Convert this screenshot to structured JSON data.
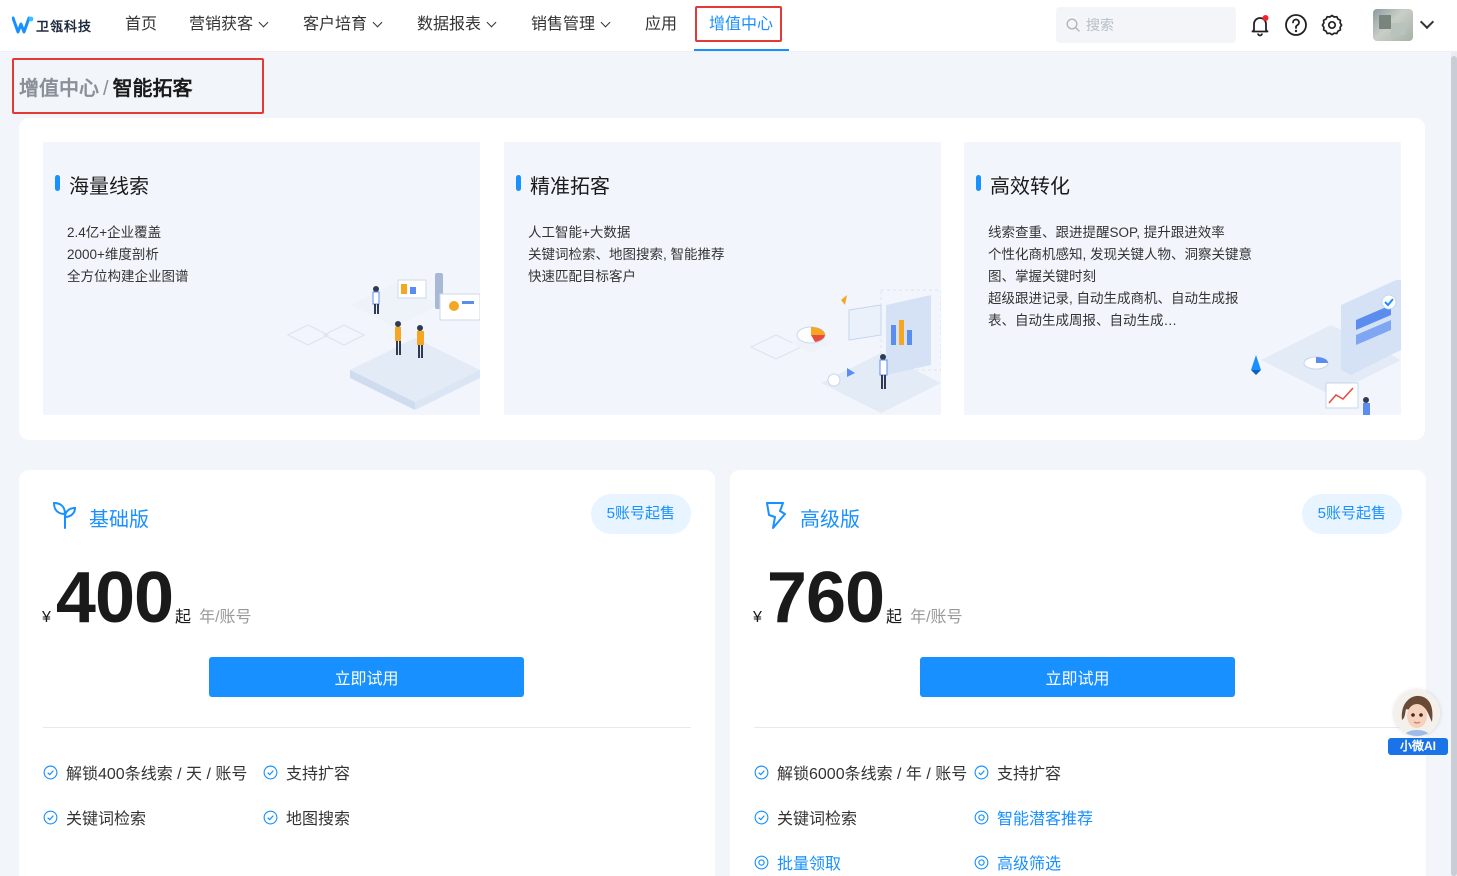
{
  "brand": {
    "name": "卫瓴科技"
  },
  "nav": {
    "items": [
      {
        "label": "首页",
        "dropdown": false
      },
      {
        "label": "营销获客",
        "dropdown": true
      },
      {
        "label": "客户培育",
        "dropdown": true
      },
      {
        "label": "数据报表",
        "dropdown": true
      },
      {
        "label": "销售管理",
        "dropdown": true
      },
      {
        "label": "应用",
        "dropdown": false
      },
      {
        "label": "增值中心",
        "dropdown": false,
        "active": true
      }
    ],
    "search_placeholder": "搜索",
    "icons": [
      "bell-icon",
      "help-icon",
      "settings-icon"
    ]
  },
  "breadcrumb": {
    "parent": "增值中心",
    "separator": "/",
    "current": "智能拓客"
  },
  "features": [
    {
      "title": "海量线索",
      "lines": [
        "2.4亿+企业覆盖",
        "2000+维度剖析",
        "全方位构建企业图谱"
      ]
    },
    {
      "title": "精准拓客",
      "lines": [
        "人工智能+大数据",
        "关键词检索、地图搜索, 智能推荐",
        "快速匹配目标客户"
      ]
    },
    {
      "title": "高效转化",
      "lines": [
        "线索查重、跟进提醒SOP, 提升跟进效率",
        "个性化商机感知, 发现关键人物、洞察关键意",
        "图、掌握关键时刻",
        "超级跟进记录, 自动生成商机、自动生成报",
        "表、自动生成周报、自动生成…"
      ]
    }
  ],
  "plans": [
    {
      "name": "基础版",
      "badge": "5账号起售",
      "currency": "¥",
      "price": "400",
      "price_suffix": "起",
      "unit": "年/账号",
      "button": "立即试用",
      "features": [
        {
          "label": "解锁400条线索 / 天 / 账号",
          "style": "check"
        },
        {
          "label": "支持扩容",
          "style": "check"
        },
        {
          "label": "关键词检索",
          "style": "check"
        },
        {
          "label": "地图搜索",
          "style": "check"
        }
      ]
    },
    {
      "name": "高级版",
      "badge": "5账号起售",
      "currency": "¥",
      "price": "760",
      "price_suffix": "起",
      "unit": "年/账号",
      "button": "立即试用",
      "features": [
        {
          "label": "解锁6000条线索 / 年 / 账号",
          "style": "check"
        },
        {
          "label": "支持扩容",
          "style": "check"
        },
        {
          "label": "关键词检索",
          "style": "check"
        },
        {
          "label": "智能潜客推荐",
          "style": "plus"
        },
        {
          "label": "批量领取",
          "style": "plus"
        },
        {
          "label": "高级筛选",
          "style": "plus"
        }
      ]
    }
  ],
  "assistant": {
    "label": "小微AI"
  },
  "colors": {
    "accent": "#1890ff",
    "highlight_border": "#e53935",
    "page_bg": "#f2f5f9"
  }
}
